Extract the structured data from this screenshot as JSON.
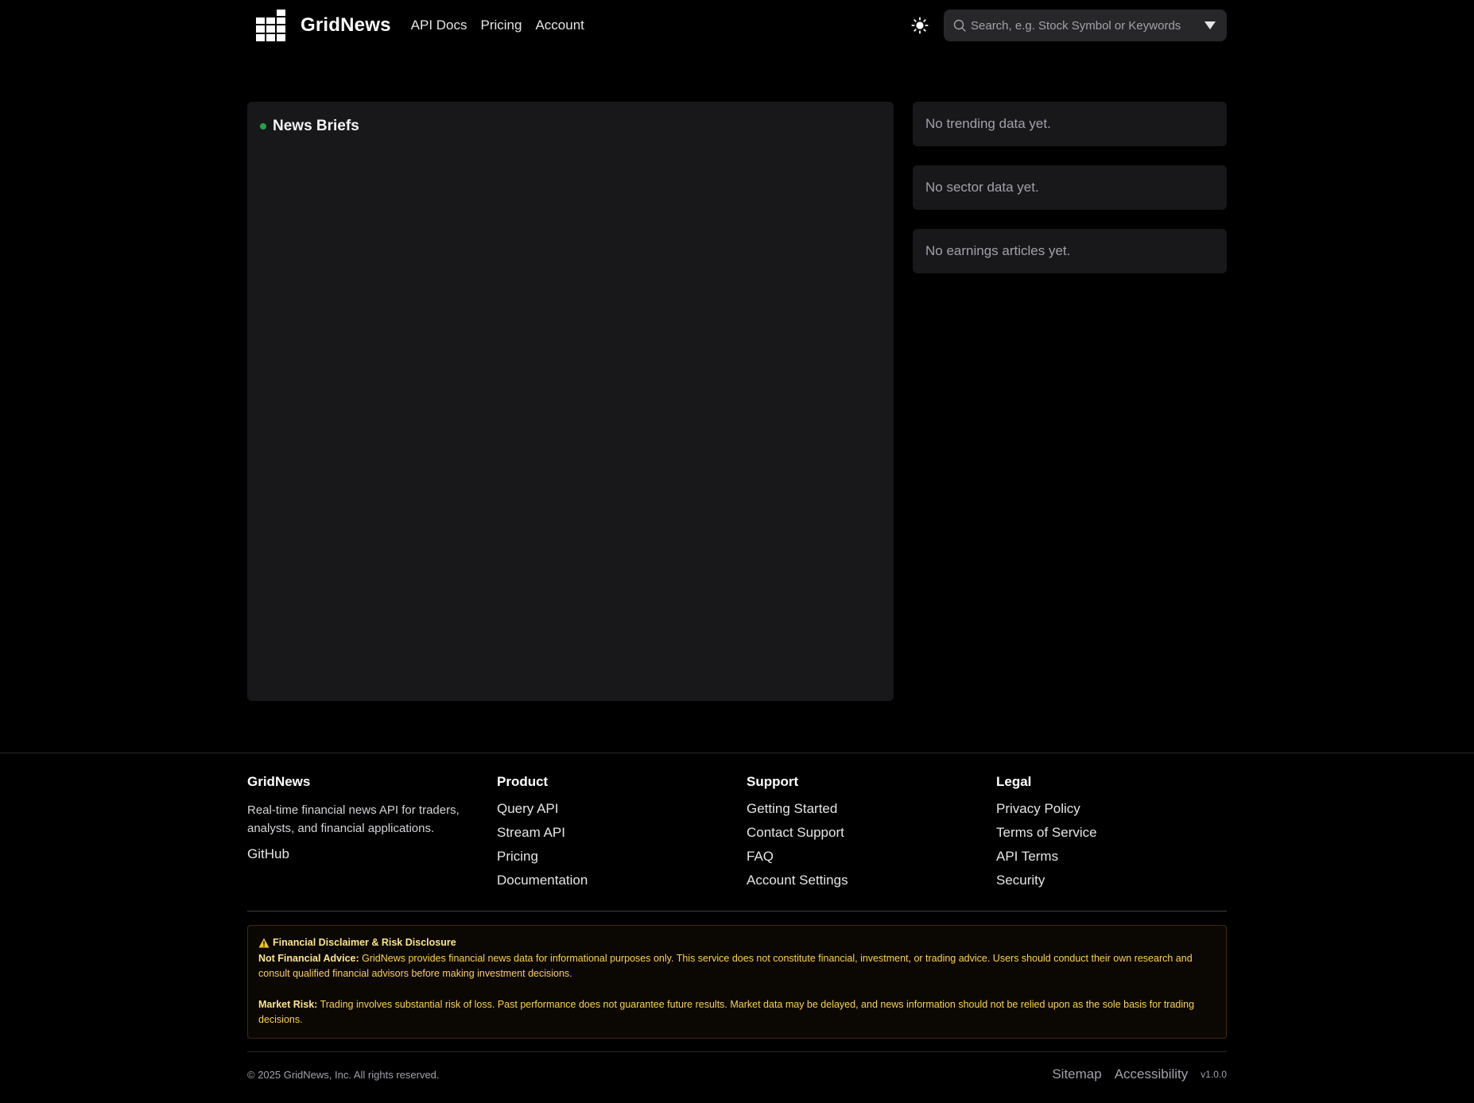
{
  "header": {
    "brand": "GridNews",
    "nav": [
      "API Docs",
      "Pricing",
      "Account"
    ],
    "search_placeholder": "Search, e.g. Stock Symbol or Keywords"
  },
  "news": {
    "title": "News Briefs"
  },
  "sidebar": {
    "trending": "No trending data yet.",
    "sector": "No sector data yet.",
    "earnings": "No earnings articles yet."
  },
  "footer": {
    "brand": "GridNews",
    "description": "Real-time financial news API for traders, analysts, and financial applications.",
    "github": "GitHub",
    "product": {
      "heading": "Product",
      "links": [
        "Query API",
        "Stream API",
        "Pricing",
        "Documentation"
      ]
    },
    "support": {
      "heading": "Support",
      "links": [
        "Getting Started",
        "Contact Support",
        "FAQ",
        "Account Settings"
      ]
    },
    "legal": {
      "heading": "Legal",
      "links": [
        "Privacy Policy",
        "Terms of Service",
        "API Terms",
        "Security"
      ]
    }
  },
  "disclaimer": {
    "title": "Financial Disclaimer & Risk Disclosure",
    "advice_label": "Not Financial Advice:",
    "advice_text": " GridNews provides financial news data for informational purposes only. This service does not constitute financial, investment, or trading advice. Users should conduct their own research and consult qualified financial advisors before making investment decisions.",
    "risk_label": "Market Risk:",
    "risk_text": " Trading involves substantial risk of loss. Past performance does not guarantee future results. Market data may be delayed, and news information should not be relied upon as the sole basis for trading decisions."
  },
  "bottom": {
    "copyright": "© 2025 GridNews, Inc. All rights reserved.",
    "sitemap": "Sitemap",
    "accessibility": "Accessibility",
    "version": "v1.0.0"
  },
  "colors": {
    "background": "#000000",
    "panel": "#18181b",
    "status_dot": "#22a447",
    "disclaimer_text": "#fcd34d"
  }
}
